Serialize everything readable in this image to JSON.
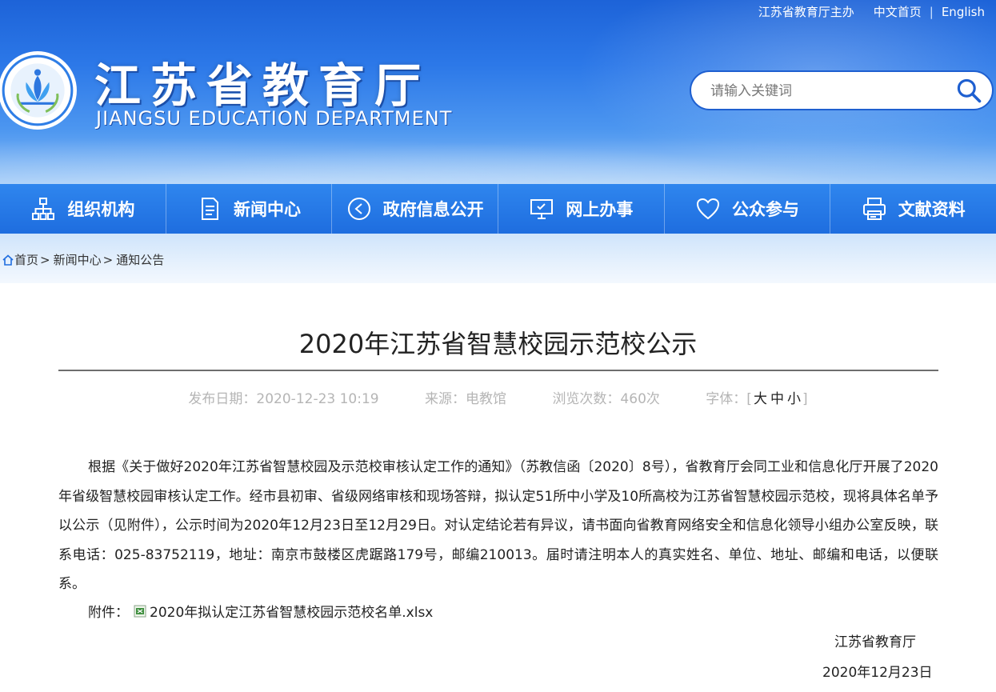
{
  "toplinks": {
    "sponsor": "江苏省教育厅主办",
    "chinese": "中文首页",
    "english": "English"
  },
  "header": {
    "title": "江苏省教育厅",
    "subtitle": "JIANGSU EDUCATION DEPARTMENT",
    "brand_color": "#2c78e8"
  },
  "search": {
    "placeholder": "请输入关键词"
  },
  "nav": {
    "items": [
      {
        "label": "组织机构",
        "icon": "org-chart-icon"
      },
      {
        "label": "新闻中心",
        "icon": "document-icon"
      },
      {
        "label": "政府信息公开",
        "icon": "play-circle-icon"
      },
      {
        "label": "网上办事",
        "icon": "monitor-icon"
      },
      {
        "label": "公众参与",
        "icon": "heart-icon"
      },
      {
        "label": "文献资料",
        "icon": "printer-icon"
      }
    ]
  },
  "breadcrumb": {
    "home": "首页",
    "news": "新闻中心",
    "current": "通知公告"
  },
  "article": {
    "title": "2020年江苏省智慧校园示范校公示",
    "publish_date": "发布日期：2020-12-23 10:19",
    "source": "来源：电教馆",
    "views": "浏览次数：460次",
    "font_label": "字体：[",
    "font_large": "大",
    "font_medium": "中",
    "font_small": "小",
    "font_close": "]",
    "body": "根据《关于做好2020年江苏省智慧校园及示范校审核认定工作的通知》（苏教信函〔2020〕8号），省教育厅会同工业和信息化厅开展了2020年省级智慧校园审核认定工作。经市县初审、省级网络审核和现场答辩，拟认定51所中小学及10所高校为江苏省智慧校园示范校，现将具体名单予以公示（见附件），公示时间为2020年12月23日至12月29日。对认定结论若有异议，请书面向省教育网络安全和信息化领导小组办公室反映，联系电话：025-83752119，地址：南京市鼓楼区虎踞路179号，邮编210013。届时请注明本人的真实姓名、单位、地址、邮编和电话，以便联系。",
    "attachment_label": "附件：",
    "attachment_file": "2020年拟认定江苏省智慧校园示范校名单.xlsx",
    "sign_org": "江苏省教育厅",
    "sign_date": "2020年12月23日"
  }
}
